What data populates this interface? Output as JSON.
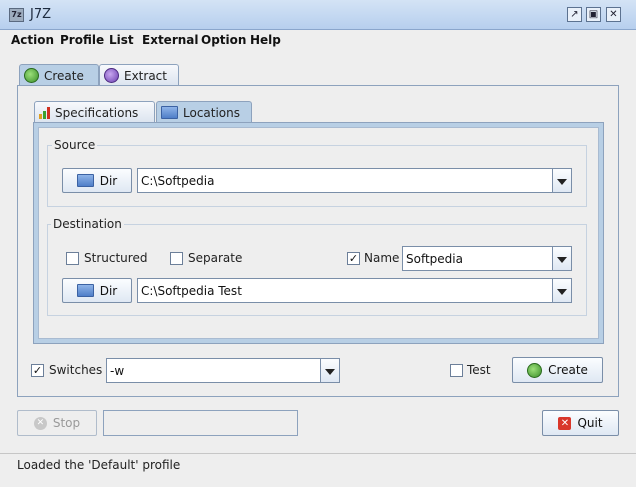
{
  "window": {
    "title": "J7Z",
    "icon_text": "7z"
  },
  "menu": [
    "Action",
    "Profile",
    "List",
    "External",
    "Option",
    "Help"
  ],
  "main_tabs": [
    {
      "label": "Create",
      "icon": "create-icon",
      "selected": true
    },
    {
      "label": "Extract",
      "icon": "extract-icon",
      "selected": false
    }
  ],
  "sub_tabs": [
    {
      "label": "Specifications",
      "icon": "bar-chart-icon",
      "selected": false
    },
    {
      "label": "Locations",
      "icon": "folder-icon",
      "selected": true
    }
  ],
  "source": {
    "group_label": "Source",
    "dir_button": "Dir",
    "path": "C:\\Softpedia"
  },
  "destination": {
    "group_label": "Destination",
    "structured_label": "Structured",
    "structured_checked": false,
    "separate_label": "Separate",
    "separate_checked": false,
    "name_label": "Name",
    "name_checked": true,
    "name_value": "Softpedia",
    "dir_button": "Dir",
    "path": "C:\\Softpedia Test"
  },
  "switches": {
    "label": "Switches",
    "checked": true,
    "value": "-w"
  },
  "test": {
    "label": "Test",
    "checked": false
  },
  "create_button": "Create",
  "stop_button": "Stop",
  "quit_button": "Quit",
  "status": "Loaded the 'Default' profile",
  "colors": {
    "selected_tab": "#b8cfe5",
    "titlebar": "#c6d9f1",
    "quit_icon": "#d9372b"
  }
}
